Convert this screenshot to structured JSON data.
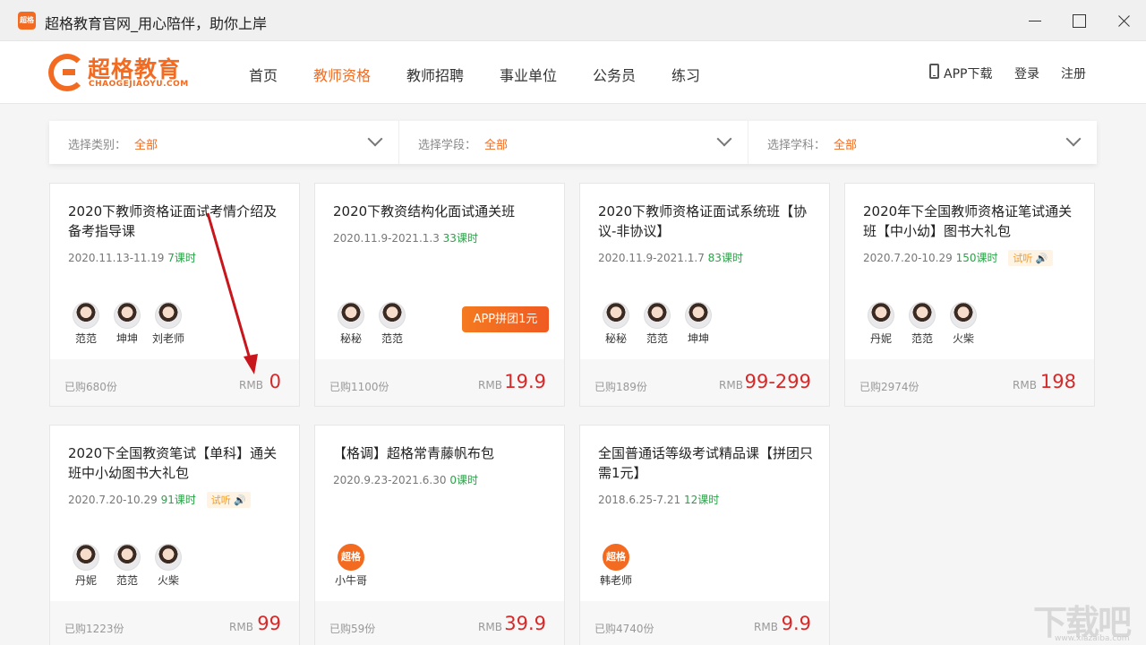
{
  "window": {
    "title": "超格教育官网_用心陪伴，助你上岸",
    "icon_text": "超格"
  },
  "logo": {
    "cn": "超格教育",
    "en": "CHAOGEJIAOYU.COM"
  },
  "nav": {
    "items": [
      "首页",
      "教师资格",
      "教师招聘",
      "事业单位",
      "公务员",
      "练习"
    ],
    "active_index": 1,
    "app_download": "APP下载",
    "login": "登录",
    "register": "注册"
  },
  "filters": [
    {
      "label": "选择类别：",
      "value": "全部"
    },
    {
      "label": "选择学段：",
      "value": "全部"
    },
    {
      "label": "选择学科：",
      "value": "全部"
    }
  ],
  "colors": {
    "accent": "#f36b21",
    "price": "#d32a2a",
    "lessons": "#2aa147"
  },
  "cards": [
    {
      "title": "2020下教师资格证面试考情介绍及备考指导课",
      "date": "2020.11.13-11.19",
      "lessons": "7课时",
      "teachers": [
        "范范",
        "坤坤",
        "刘老师"
      ],
      "sold": "已购680份",
      "currency": "RMB",
      "price": "0"
    },
    {
      "title": "2020下教资结构化面试通关班",
      "date": "2020.11.9-2021.1.3",
      "lessons": "33课时",
      "teachers": [
        "秘秘",
        "范范"
      ],
      "badge": "APP拼团1元",
      "sold": "已购1100份",
      "currency": "RMB",
      "price": "19.9"
    },
    {
      "title": "2020下教师资格证面试系统班【协议-非协议】",
      "date": "2020.11.9-2021.1.7",
      "lessons": "83课时",
      "teachers": [
        "秘秘",
        "范范",
        "坤坤"
      ],
      "sold": "已购189份",
      "currency": "RMB",
      "price": "99-299"
    },
    {
      "title": "2020年下全国教师资格证笔试通关班【中小幼】图书大礼包",
      "date": "2020.7.20-10.29",
      "lessons": "150课时",
      "trial": "试听",
      "teachers": [
        "丹妮",
        "范范",
        "火柴"
      ],
      "sold": "已购2974份",
      "currency": "RMB",
      "price": "198"
    },
    {
      "title": "2020下全国教资笔试【单科】通关班中小幼图书大礼包",
      "date": "2020.7.20-10.29",
      "lessons": "91课时",
      "trial": "试听",
      "teachers": [
        "丹妮",
        "范范",
        "火柴"
      ],
      "sold": "已购1223份",
      "currency": "RMB",
      "price": "99"
    },
    {
      "title": "【格调】超格常青藤帆布包",
      "date": "2020.9.23-2021.6.30",
      "lessons": "0课时",
      "teachers": [
        "小牛哥"
      ],
      "brand_avatar": "超格",
      "sold": "已购59份",
      "currency": "RMB",
      "price": "39.9"
    },
    {
      "title": "全国普通话等级考试精品课【拼团只需1元】",
      "date": "2018.6.25-7.21",
      "lessons": "12课时",
      "teachers": [
        "韩老师"
      ],
      "brand_avatar": "超格",
      "sold": "已购4740份",
      "currency": "RMB",
      "price": "9.9"
    }
  ],
  "watermark": {
    "main": "下载吧",
    "sub": "www.xiazaiba.com"
  }
}
